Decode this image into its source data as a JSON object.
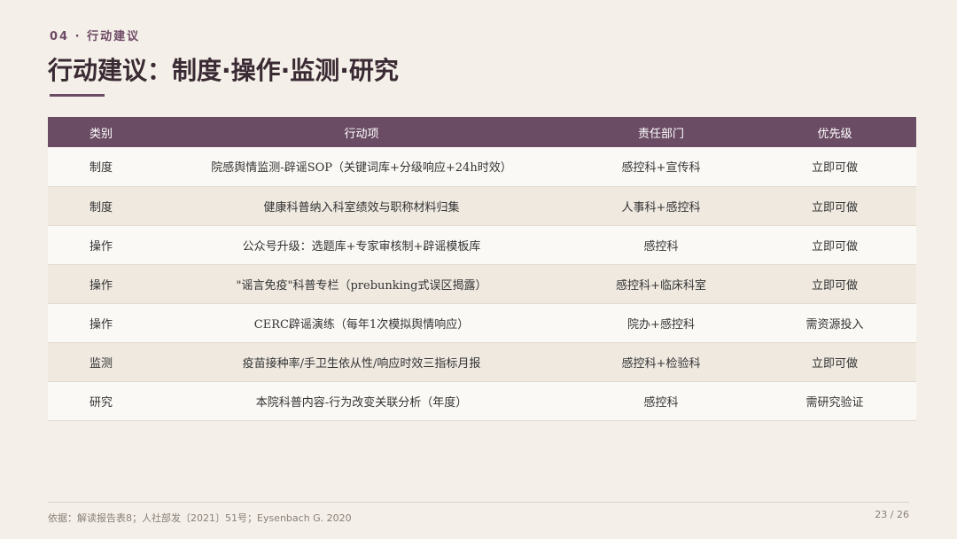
{
  "header": {
    "section_label": "04 · 行动建议",
    "title": "行动建议：制度·操作·监测·研究"
  },
  "table": {
    "columns": [
      "类别",
      "行动项",
      "责任部门",
      "优先级"
    ],
    "rows": [
      [
        "制度",
        "院感舆情监测-辟谣SOP（关键词库+分级响应+24h时效）",
        "感控科+宣传科",
        "立即可做"
      ],
      [
        "制度",
        "健康科普纳入科室绩效与职称材料归集",
        "人事科+感控科",
        "立即可做"
      ],
      [
        "操作",
        "公众号升级：选题库+专家审核制+辟谣模板库",
        "感控科",
        "立即可做"
      ],
      [
        "操作",
        "\"谣言免疫\"科普专栏（prebunking式误区揭露）",
        "感控科+临床科室",
        "立即可做"
      ],
      [
        "操作",
        "CERC辟谣演练（每年1次模拟舆情响应）",
        "院办+感控科",
        "需资源投入"
      ],
      [
        "监测",
        "疫苗接种率/手卫生依从性/响应时效三指标月报",
        "感控科+检验科",
        "立即可做"
      ],
      [
        "研究",
        "本院科普内容-行为改变关联分析（年度）",
        "感控科",
        "需研究验证"
      ]
    ]
  },
  "footer": {
    "source": "依据：解读报告表8；人社部发〔2021〕51号；Eysenbach G. 2020",
    "page": "23 / 26"
  }
}
